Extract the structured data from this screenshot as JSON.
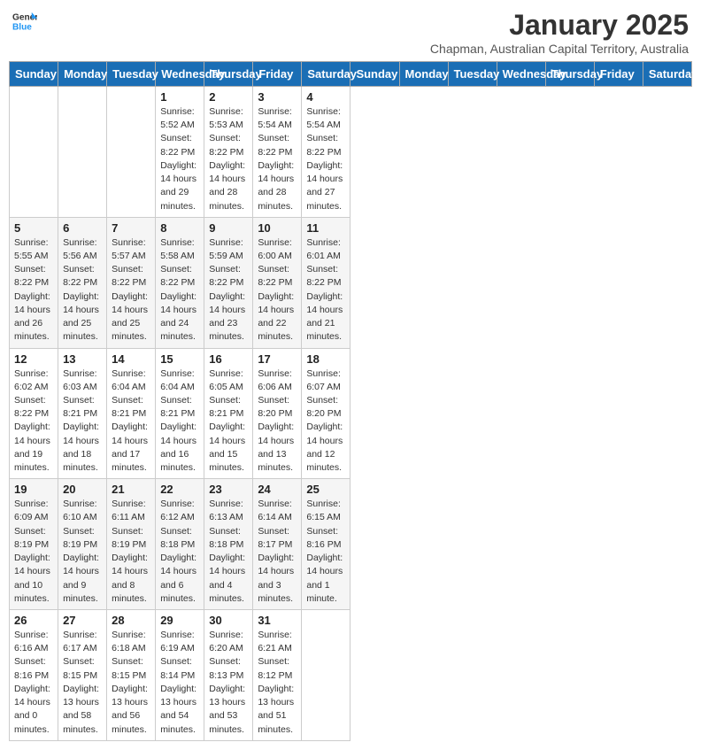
{
  "header": {
    "logo_general": "General",
    "logo_blue": "Blue",
    "month": "January 2025",
    "location": "Chapman, Australian Capital Territory, Australia"
  },
  "days_of_week": [
    "Sunday",
    "Monday",
    "Tuesday",
    "Wednesday",
    "Thursday",
    "Friday",
    "Saturday"
  ],
  "weeks": [
    [
      {
        "day": "",
        "info": ""
      },
      {
        "day": "",
        "info": ""
      },
      {
        "day": "",
        "info": ""
      },
      {
        "day": "1",
        "info": "Sunrise: 5:52 AM\nSunset: 8:22 PM\nDaylight: 14 hours and 29 minutes."
      },
      {
        "day": "2",
        "info": "Sunrise: 5:53 AM\nSunset: 8:22 PM\nDaylight: 14 hours and 28 minutes."
      },
      {
        "day": "3",
        "info": "Sunrise: 5:54 AM\nSunset: 8:22 PM\nDaylight: 14 hours and 28 minutes."
      },
      {
        "day": "4",
        "info": "Sunrise: 5:54 AM\nSunset: 8:22 PM\nDaylight: 14 hours and 27 minutes."
      }
    ],
    [
      {
        "day": "5",
        "info": "Sunrise: 5:55 AM\nSunset: 8:22 PM\nDaylight: 14 hours and 26 minutes."
      },
      {
        "day": "6",
        "info": "Sunrise: 5:56 AM\nSunset: 8:22 PM\nDaylight: 14 hours and 25 minutes."
      },
      {
        "day": "7",
        "info": "Sunrise: 5:57 AM\nSunset: 8:22 PM\nDaylight: 14 hours and 25 minutes."
      },
      {
        "day": "8",
        "info": "Sunrise: 5:58 AM\nSunset: 8:22 PM\nDaylight: 14 hours and 24 minutes."
      },
      {
        "day": "9",
        "info": "Sunrise: 5:59 AM\nSunset: 8:22 PM\nDaylight: 14 hours and 23 minutes."
      },
      {
        "day": "10",
        "info": "Sunrise: 6:00 AM\nSunset: 8:22 PM\nDaylight: 14 hours and 22 minutes."
      },
      {
        "day": "11",
        "info": "Sunrise: 6:01 AM\nSunset: 8:22 PM\nDaylight: 14 hours and 21 minutes."
      }
    ],
    [
      {
        "day": "12",
        "info": "Sunrise: 6:02 AM\nSunset: 8:22 PM\nDaylight: 14 hours and 19 minutes."
      },
      {
        "day": "13",
        "info": "Sunrise: 6:03 AM\nSunset: 8:21 PM\nDaylight: 14 hours and 18 minutes."
      },
      {
        "day": "14",
        "info": "Sunrise: 6:04 AM\nSunset: 8:21 PM\nDaylight: 14 hours and 17 minutes."
      },
      {
        "day": "15",
        "info": "Sunrise: 6:04 AM\nSunset: 8:21 PM\nDaylight: 14 hours and 16 minutes."
      },
      {
        "day": "16",
        "info": "Sunrise: 6:05 AM\nSunset: 8:21 PM\nDaylight: 14 hours and 15 minutes."
      },
      {
        "day": "17",
        "info": "Sunrise: 6:06 AM\nSunset: 8:20 PM\nDaylight: 14 hours and 13 minutes."
      },
      {
        "day": "18",
        "info": "Sunrise: 6:07 AM\nSunset: 8:20 PM\nDaylight: 14 hours and 12 minutes."
      }
    ],
    [
      {
        "day": "19",
        "info": "Sunrise: 6:09 AM\nSunset: 8:19 PM\nDaylight: 14 hours and 10 minutes."
      },
      {
        "day": "20",
        "info": "Sunrise: 6:10 AM\nSunset: 8:19 PM\nDaylight: 14 hours and 9 minutes."
      },
      {
        "day": "21",
        "info": "Sunrise: 6:11 AM\nSunset: 8:19 PM\nDaylight: 14 hours and 8 minutes."
      },
      {
        "day": "22",
        "info": "Sunrise: 6:12 AM\nSunset: 8:18 PM\nDaylight: 14 hours and 6 minutes."
      },
      {
        "day": "23",
        "info": "Sunrise: 6:13 AM\nSunset: 8:18 PM\nDaylight: 14 hours and 4 minutes."
      },
      {
        "day": "24",
        "info": "Sunrise: 6:14 AM\nSunset: 8:17 PM\nDaylight: 14 hours and 3 minutes."
      },
      {
        "day": "25",
        "info": "Sunrise: 6:15 AM\nSunset: 8:16 PM\nDaylight: 14 hours and 1 minute."
      }
    ],
    [
      {
        "day": "26",
        "info": "Sunrise: 6:16 AM\nSunset: 8:16 PM\nDaylight: 14 hours and 0 minutes."
      },
      {
        "day": "27",
        "info": "Sunrise: 6:17 AM\nSunset: 8:15 PM\nDaylight: 13 hours and 58 minutes."
      },
      {
        "day": "28",
        "info": "Sunrise: 6:18 AM\nSunset: 8:15 PM\nDaylight: 13 hours and 56 minutes."
      },
      {
        "day": "29",
        "info": "Sunrise: 6:19 AM\nSunset: 8:14 PM\nDaylight: 13 hours and 54 minutes."
      },
      {
        "day": "30",
        "info": "Sunrise: 6:20 AM\nSunset: 8:13 PM\nDaylight: 13 hours and 53 minutes."
      },
      {
        "day": "31",
        "info": "Sunrise: 6:21 AM\nSunset: 8:12 PM\nDaylight: 13 hours and 51 minutes."
      },
      {
        "day": "",
        "info": ""
      }
    ]
  ]
}
